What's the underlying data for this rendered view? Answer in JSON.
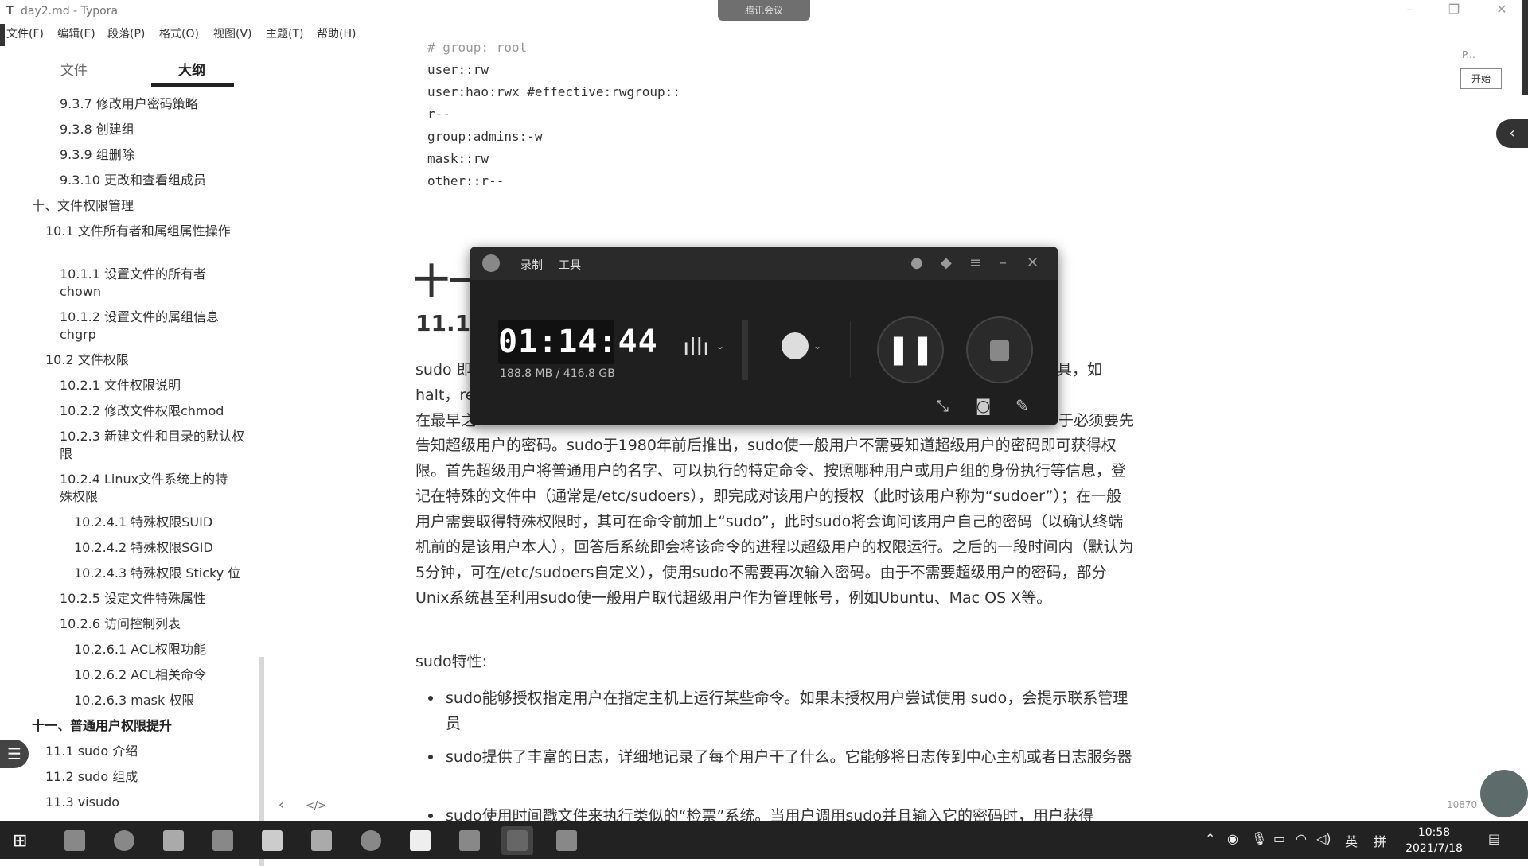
{
  "window": {
    "title": "day2.md - Typora",
    "meeting_label": "腾讯会议"
  },
  "menu": [
    "文件(F)",
    "编辑(E)",
    "段落(P)",
    "格式(O)",
    "视图(V)",
    "主题(T)",
    "帮助(H)"
  ],
  "sidebar": {
    "tabs": [
      "文件",
      "大纲"
    ],
    "active_tab": "大纲",
    "outline": [
      {
        "label": "9.3.7 修改用户密码策略",
        "level": 3
      },
      {
        "label": "9.3.8 创建组",
        "level": 3
      },
      {
        "label": "9.3.9 组删除",
        "level": 3
      },
      {
        "label": "9.3.10 更改和查看组成员",
        "level": 3
      },
      {
        "label": "十、文件权限管理",
        "level": 1
      },
      {
        "label": "10.1 文件所有者和属组属性操作",
        "level": 2
      },
      {
        "label": "10.1.1 设置文件的所有者chown",
        "level": 3
      },
      {
        "label": "10.1.2 设置文件的属组信息chgrp",
        "level": 3
      },
      {
        "label": "10.2 文件权限",
        "level": 2
      },
      {
        "label": "10.2.1 文件权限说明",
        "level": 3
      },
      {
        "label": "10.2.2 修改文件权限chmod",
        "level": 3
      },
      {
        "label": "10.2.3 新建文件和目录的默认权限",
        "level": 3
      },
      {
        "label": "10.2.4 Linux文件系统上的特殊权限",
        "level": 3
      },
      {
        "label": "10.2.4.1 特殊权限SUID",
        "level": 4
      },
      {
        "label": "10.2.4.2 特殊权限SGID",
        "level": 4
      },
      {
        "label": "10.2.4.3 特殊权限 Sticky 位",
        "level": 4
      },
      {
        "label": "10.2.5 设定文件特殊属性",
        "level": 3
      },
      {
        "label": "10.2.6 访问控制列表",
        "level": 3
      },
      {
        "label": "10.2.6.1 ACL权限功能",
        "level": 4
      },
      {
        "label": "10.2.6.2 ACL相关命令",
        "level": 4
      },
      {
        "label": "10.2.6.3 mask 权限",
        "level": 4
      },
      {
        "label": "十一、普通用户权限提升",
        "level": 1
      },
      {
        "label": "11.1 sudo 介绍",
        "level": 2
      },
      {
        "label": "11.2 sudo 组成",
        "level": 2
      },
      {
        "label": "11.3 visudo",
        "level": 2
      }
    ],
    "footer_icons": [
      "‹",
      "</>"
    ]
  },
  "editor": {
    "code_lines": [
      "# group: root",
      "user::rw",
      "user:hao:rwx #effective:rwgroup::",
      "r--",
      "group:admins:-w",
      "mask::rw",
      "other::r--"
    ],
    "h1_partial": "十一",
    "h2_partial": "11.1",
    "frag_sudo": "sudo 即",
    "frag_ru": "具，如",
    "frag_halt": "halt，re",
    "frag_zuizao": "在最早之",
    "frag_xian": "于必须要先",
    "paragraph_rest": "告知超级用户的密码。sudo于1980年前后推出，sudo使一般用户不需要知道超级用户的密码即可获得权限。首先超级用户将普通用户的名字、可以执行的特定命令、按照哪种用户或用户组的身份执行等信息，登记在特殊的文件中（通常是/etc/sudoers），即完成对该用户的授权（此时该用户称为“sudoer”）；在一般用户需要取得特殊权限时，其可在命令前加上“sudo”，此时sudo将会询问该用户自己的密码（以确认终端机前的是该用户本人），回答后系统即会将该命令的进程以超级用户的权限运行。之后的一段时间内（默认为5分钟，可在/etc/sudoers自定义），使用sudo不需要再次输入密码。由于不需要超级用户的密码，部分Unix系统甚至利用sudo使一般用户取代超级用户作为管理帐号，例如Ubuntu、Mac OS X等。",
    "features_label": "sudo特性:",
    "bullets": [
      "sudo能够授权指定用户在指定主机上运行某些命令。如果未授权用户尝试使用 sudo，会提示联系管理员",
      "sudo提供了丰富的日志，详细地记录了每个用户干了什么。它能够将日志传到中心主机或者日志服务器",
      "sudo使用时间戳文件来执行类似的“检票”系统。当用户调用sudo并且输入它的密码时，用户获得"
    ]
  },
  "right_panel": {
    "p_label": "P...",
    "start_button": "开始",
    "collapse": "‹",
    "word_count": "10870"
  },
  "recorder": {
    "tabs": [
      "录制",
      "工具"
    ],
    "timer": "01:14:44",
    "storage": "188.8 MB / 416.8 GB"
  },
  "taskbar": {
    "tray_lang": "英",
    "tray_ime": "拼",
    "time": "10:58",
    "date": "2021/7/18"
  }
}
